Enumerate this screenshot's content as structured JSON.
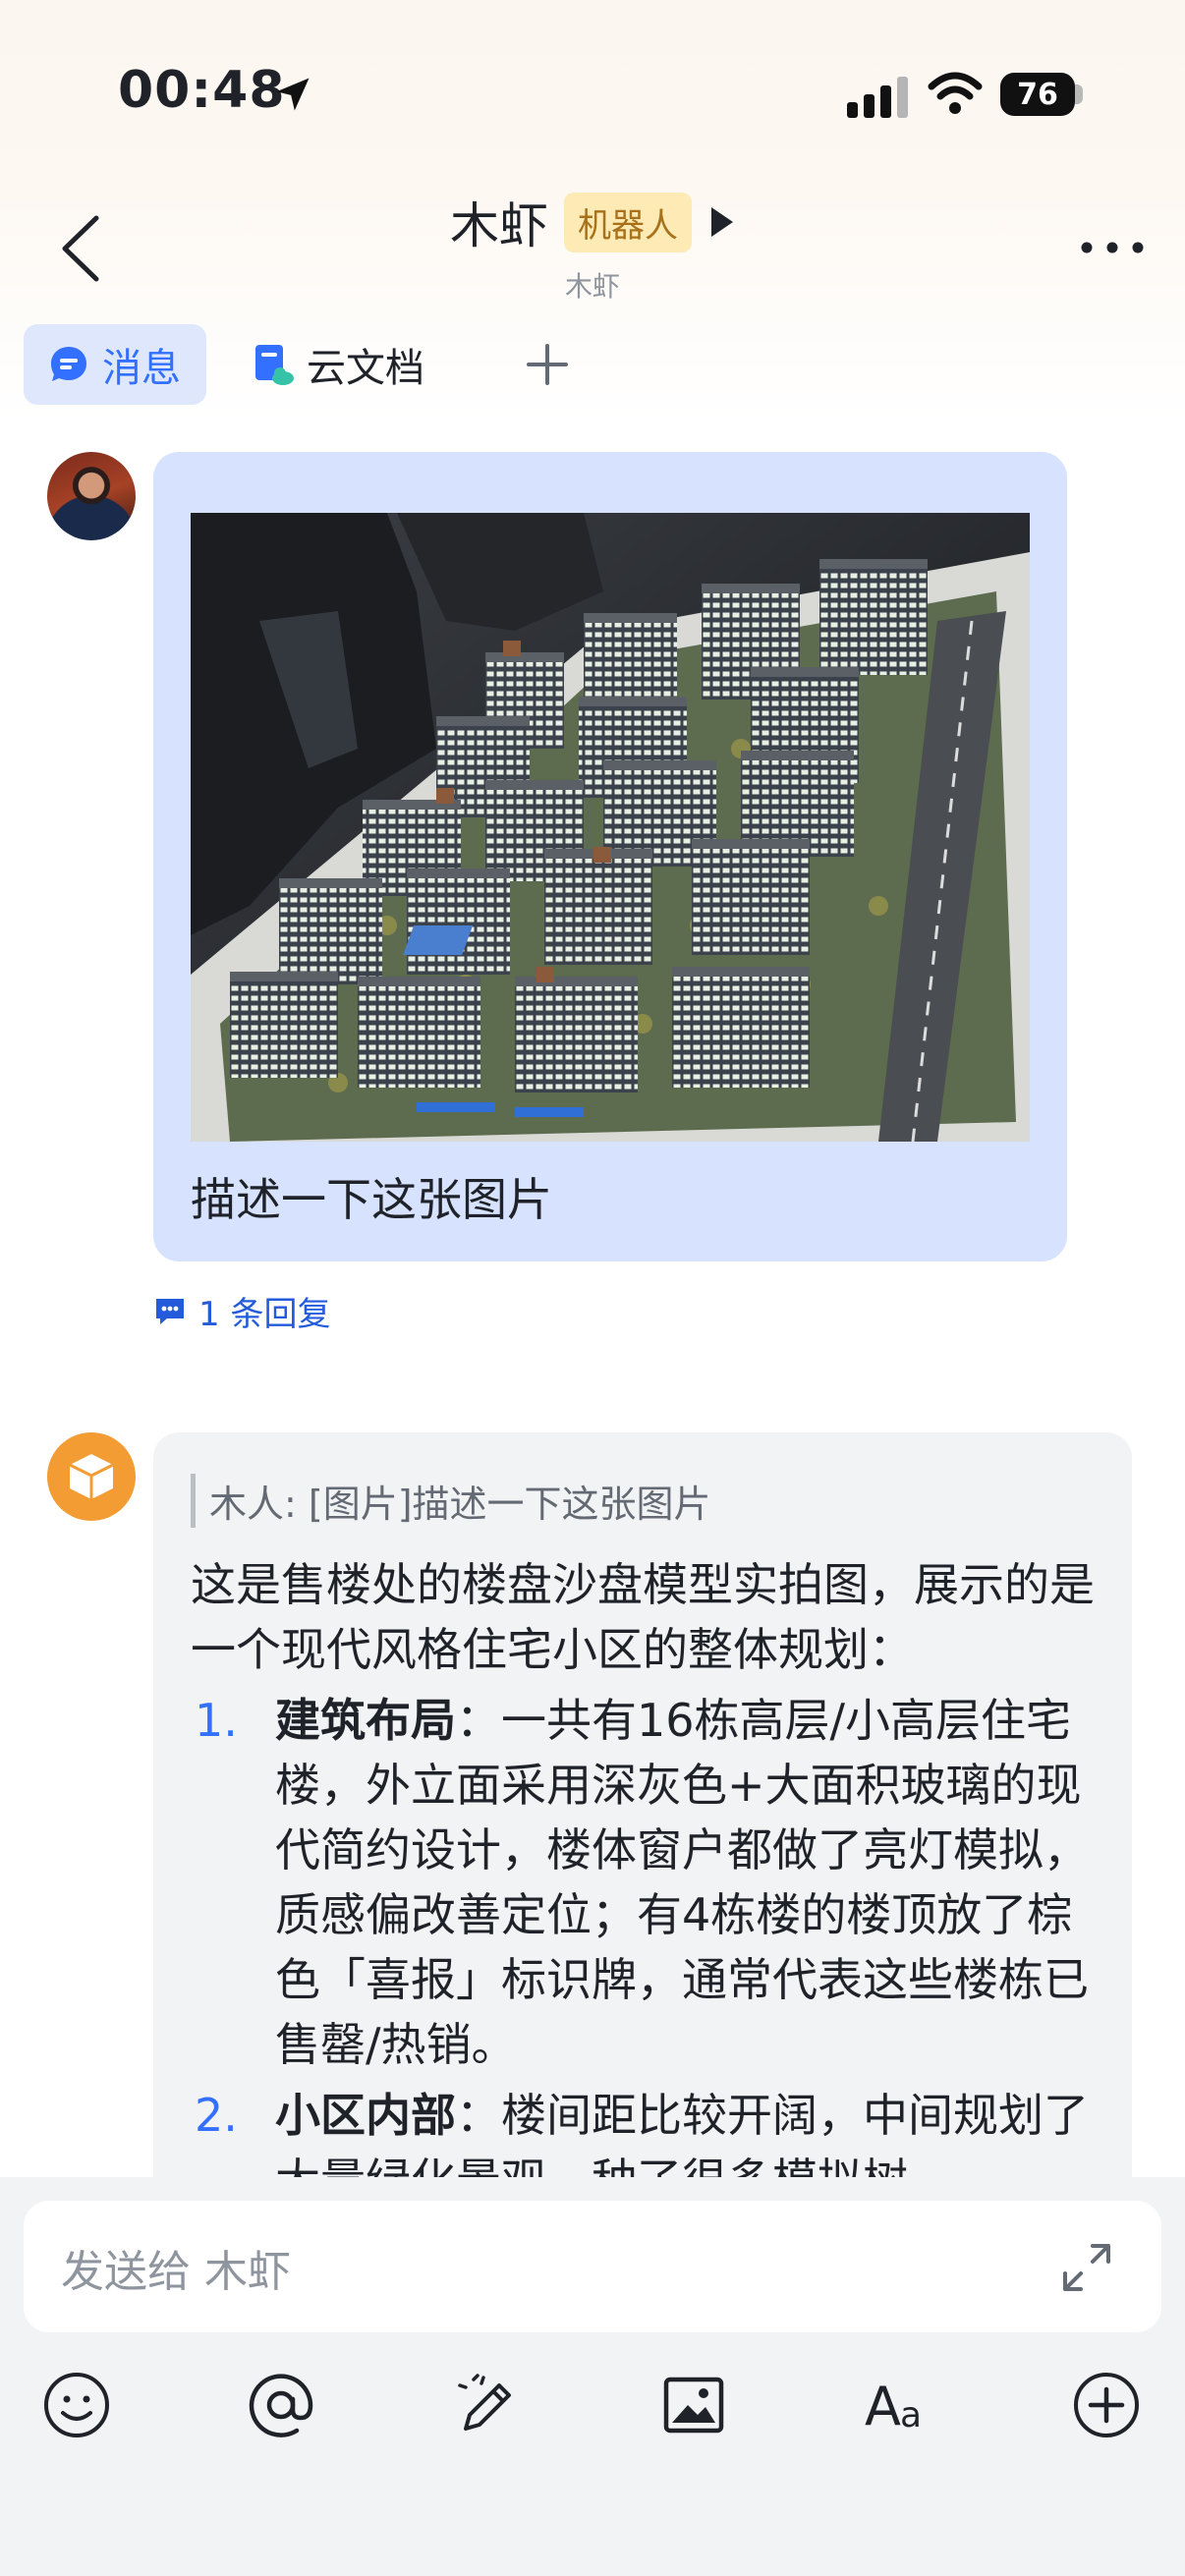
{
  "status_bar": {
    "time": "00:48",
    "battery": "76"
  },
  "header": {
    "title": "木虾",
    "tag": "机器人",
    "subtitle": "木虾"
  },
  "tabs": [
    {
      "label": "消息",
      "active": true
    },
    {
      "label": "云文档",
      "active": false
    }
  ],
  "messages": {
    "user": {
      "text": "描述一下这张图片",
      "reply_count": "1 条回复"
    },
    "bot": {
      "quote": "木人: [图片]描述一下这张图片",
      "intro": "这是售楼处的楼盘沙盘模型实拍图，展示的是一个现代风格住宅小区的整体规划：",
      "items": [
        {
          "num": "1.",
          "head": "建筑布局",
          "body": "：一共有16栋高层/小高层住宅楼，外立面采用深灰色+大面积玻璃的现代简约设计，楼体窗户都做了亮灯模拟，质感偏改善定位；有4栋楼的楼顶放了棕色「喜报」标识牌，通常代表这些楼栋已售罄/热销。"
        },
        {
          "num": "2.",
          "head": "小区内部",
          "body": "：楼间距比较开阔，中间规划了大量绿化景观，种了很多模拟树"
        }
      ]
    }
  },
  "input": {
    "placeholder": "发送给 木虾"
  },
  "colors": {
    "accent": "#3370ff",
    "user_bubble": "#d6e2fe",
    "bot_bubble": "#f2f3f5",
    "tag_bg": "#fdeab4",
    "bot_avatar": "#f39c33"
  }
}
